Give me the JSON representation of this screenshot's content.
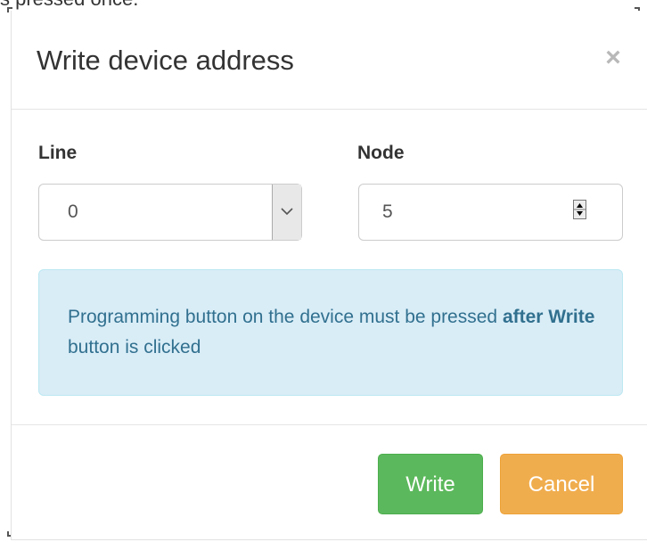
{
  "background": {
    "cut_off_text": "s pressed once."
  },
  "dialog": {
    "title": "Write device address",
    "close_glyph": "×",
    "close_icon": "close-icon"
  },
  "form": {
    "line": {
      "label": "Line",
      "value": "0",
      "icon": "chevron-down-icon"
    },
    "node": {
      "label": "Node",
      "value": "5",
      "icon": "spinner-arrows-icon"
    }
  },
  "alert": {
    "text_before": "Programming button on the device must be pressed ",
    "text_bold": "after Write",
    "text_after": " button is clicked",
    "background_color": "#d9edf7",
    "text_color": "#31708f"
  },
  "footer": {
    "write_label": "Write",
    "cancel_label": "Cancel",
    "write_color": "#5cb85c",
    "cancel_color": "#f0ad4e"
  }
}
